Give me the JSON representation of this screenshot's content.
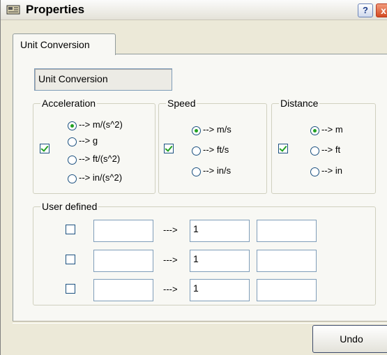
{
  "window": {
    "title": "Properties",
    "help_label": "?",
    "close_label": "x"
  },
  "tabs": [
    {
      "label": "Unit Conversion"
    }
  ],
  "name_field": {
    "value": "Unit Conversion"
  },
  "acceleration": {
    "legend": "Acceleration",
    "checked": true,
    "options": [
      {
        "label": "--> m/(s^2)",
        "selected": true
      },
      {
        "label": "--> g",
        "selected": false
      },
      {
        "label": "--> ft/(s^2)",
        "selected": false
      },
      {
        "label": "--> in/(s^2)",
        "selected": false
      }
    ]
  },
  "speed": {
    "legend": "Speed",
    "checked": true,
    "options": [
      {
        "label": "--> m/s",
        "selected": true
      },
      {
        "label": "--> ft/s",
        "selected": false
      },
      {
        "label": "--> in/s",
        "selected": false
      }
    ]
  },
  "distance": {
    "legend": "Distance",
    "checked": true,
    "options": [
      {
        "label": "--> m",
        "selected": true
      },
      {
        "label": "--> ft",
        "selected": false
      },
      {
        "label": "--> in",
        "selected": false
      }
    ]
  },
  "user_defined": {
    "legend": "User defined",
    "rows": [
      {
        "checked": false,
        "from": "",
        "arrow": "--->",
        "factor": "1",
        "to": ""
      },
      {
        "checked": false,
        "from": "",
        "arrow": "--->",
        "factor": "1",
        "to": ""
      },
      {
        "checked": false,
        "from": "",
        "arrow": "--->",
        "factor": "1",
        "to": ""
      }
    ]
  },
  "footer": {
    "undo_label": "Undo"
  }
}
